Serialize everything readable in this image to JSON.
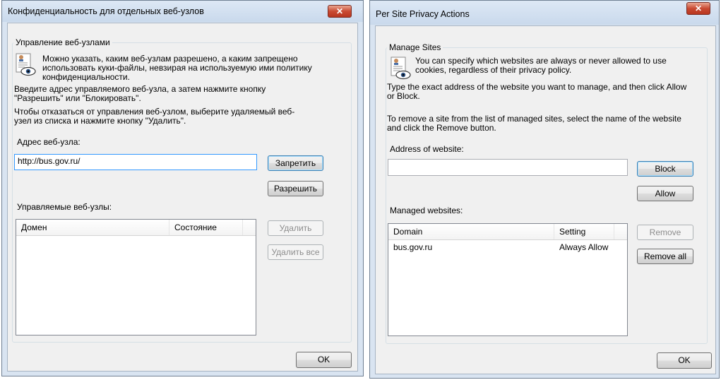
{
  "ru": {
    "title": "Конфиденциальность для отдельных веб-узлов",
    "group_label": "Управление веб-узлами",
    "description": "Можно указать, каким веб-узлам разрешено, а каким запрещено использовать куки-файлы, невзирая на используемую ими политику конфиденциальности.",
    "instruction": "Введите адрес управляемого веб-узла, а затем нажмите кнопку \"Разрешить\" или \"Блокировать\".",
    "remove_instruction": "Чтобы отказаться от управления веб-узлом, выберите удаляемый веб-узел из списка и нажмите кнопку \"Удалить\".",
    "address_label": "Адрес веб-узла:",
    "address_value": "http://bus.gov.ru/",
    "block_button": "Запретить",
    "allow_button": "Разрешить",
    "managed_label": "Управляемые веб-узлы:",
    "columns": [
      "Домен",
      "Состояние"
    ],
    "rows": [],
    "remove_button": "Удалить",
    "remove_all_button": "Удалить все",
    "ok_button": "OK",
    "close_glyph": "✕"
  },
  "en": {
    "title": "Per Site Privacy Actions",
    "group_label": "Manage Sites",
    "description": "You can specify which websites are always or never allowed to use cookies, regardless of their privacy policy.",
    "instruction": "Type the exact address of the website you want to manage, and then click Allow or Block.",
    "remove_instruction": "To remove a site from the list of managed sites, select the name of the website and click the Remove button.",
    "address_label": "Address of website:",
    "address_value": "",
    "block_button": "Block",
    "allow_button": "Allow",
    "managed_label": "Managed websites:",
    "columns": [
      "Domain",
      "Setting"
    ],
    "rows": [
      {
        "domain": "bus.gov.ru",
        "setting": "Always Allow"
      }
    ],
    "remove_button": "Remove",
    "remove_all_button": "Remove all",
    "ok_button": "OK",
    "close_glyph": "✕"
  },
  "icons": {
    "privacy": "privacy-eye-icon",
    "close": "close-icon"
  },
  "colors": {
    "close_button": "#c94a32",
    "default_button_border": "#3c7fb1",
    "focus_border": "#3399ff"
  }
}
